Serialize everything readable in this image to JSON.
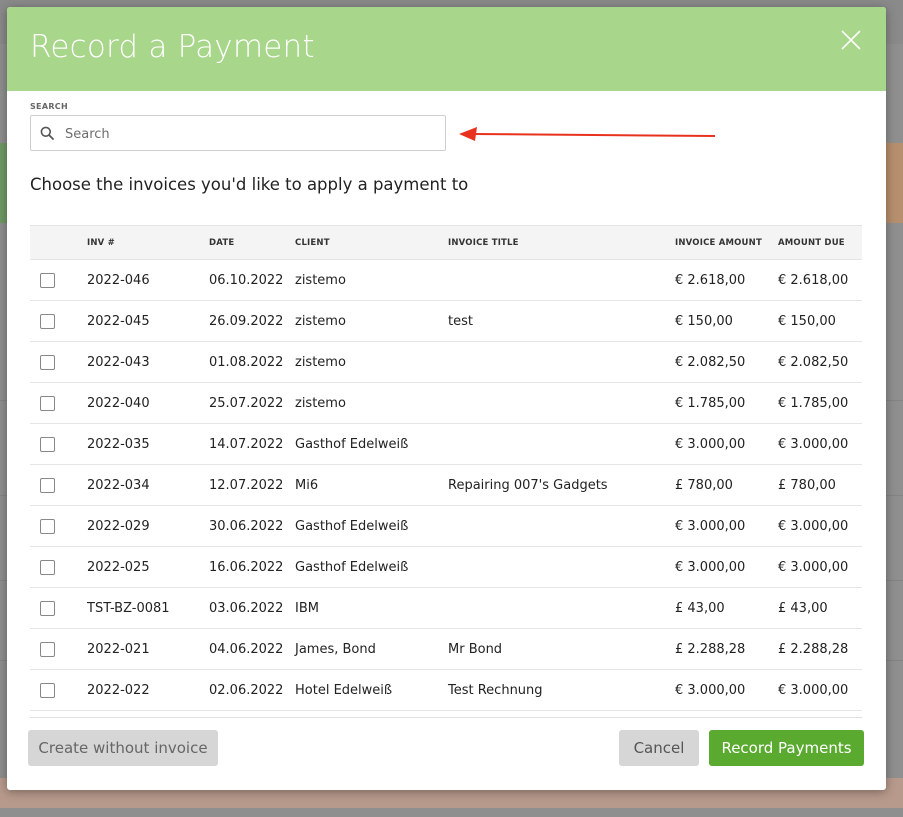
{
  "modal": {
    "title": "Record a Payment",
    "search_label": "SEARCH",
    "search_placeholder": "Search",
    "search_value": "",
    "subtitle": "Choose the invoices you'd like to apply a payment to"
  },
  "table": {
    "headers": [
      "INV #",
      "DATE",
      "CLIENT",
      "INVOICE TITLE",
      "INVOICE AMOUNT",
      "AMOUNT DUE"
    ],
    "rows": [
      {
        "inv": "2022-046",
        "date": "06.10.2022",
        "client": "zistemo",
        "title": "",
        "amount": "€ 2.618,00",
        "due": "€ 2.618,00"
      },
      {
        "inv": "2022-045",
        "date": "26.09.2022",
        "client": "zistemo",
        "title": "test",
        "amount": "€ 150,00",
        "due": "€ 150,00"
      },
      {
        "inv": "2022-043",
        "date": "01.08.2022",
        "client": "zistemo",
        "title": "",
        "amount": "€ 2.082,50",
        "due": "€ 2.082,50"
      },
      {
        "inv": "2022-040",
        "date": "25.07.2022",
        "client": "zistemo",
        "title": "",
        "amount": "€ 1.785,00",
        "due": "€ 1.785,00"
      },
      {
        "inv": "2022-035",
        "date": "14.07.2022",
        "client": "Gasthof Edelweiß",
        "title": "",
        "amount": "€ 3.000,00",
        "due": "€ 3.000,00"
      },
      {
        "inv": "2022-034",
        "date": "12.07.2022",
        "client": "Mi6",
        "title": "Repairing 007's Gadgets",
        "amount": "£ 780,00",
        "due": "£ 780,00"
      },
      {
        "inv": "2022-029",
        "date": "30.06.2022",
        "client": "Gasthof Edelweiß",
        "title": "",
        "amount": "€ 3.000,00",
        "due": "€ 3.000,00"
      },
      {
        "inv": "2022-025",
        "date": "16.06.2022",
        "client": "Gasthof Edelweiß",
        "title": "",
        "amount": "€ 3.000,00",
        "due": "€ 3.000,00"
      },
      {
        "inv": "TST-BZ-0081",
        "date": "03.06.2022",
        "client": "IBM",
        "title": "",
        "amount": "£ 43,00",
        "due": "£ 43,00"
      },
      {
        "inv": "2022-021",
        "date": "04.06.2022",
        "client": "James, Bond",
        "title": "Mr Bond",
        "amount": "£ 2.288,28",
        "due": "£ 2.288,28"
      },
      {
        "inv": "2022-022",
        "date": "02.06.2022",
        "client": "Hotel Edelweiß",
        "title": "Test Rechnung",
        "amount": "€ 3.000,00",
        "due": "€ 3.000,00"
      }
    ]
  },
  "footer": {
    "create_label": "Create without invoice",
    "cancel_label": "Cancel",
    "record_label": "Record Payments"
  },
  "colors": {
    "header_green": "#a8d68a",
    "primary_button": "#5aaa2f",
    "annotation_arrow": "#e8321e"
  },
  "icons": [
    "close-icon",
    "search-icon",
    "annotation-arrow"
  ]
}
